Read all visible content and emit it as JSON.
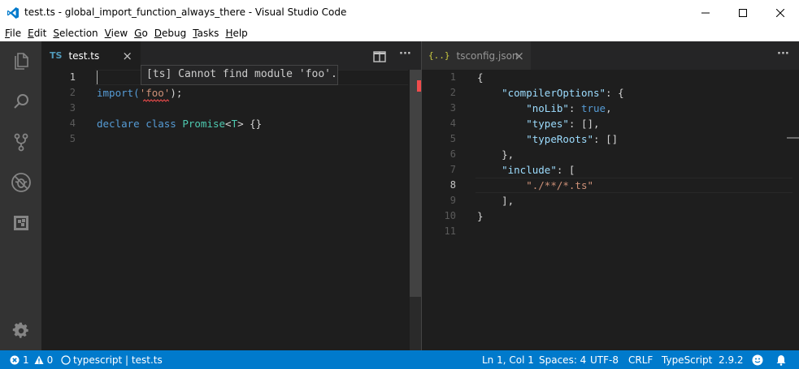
{
  "window": {
    "title": "test.ts - global_import_function_always_there - Visual Studio Code"
  },
  "menu": [
    "File",
    "Edit",
    "Selection",
    "View",
    "Go",
    "Debug",
    "Tasks",
    "Help"
  ],
  "menu_mnemonics": [
    "F",
    "E",
    "S",
    "V",
    "G",
    "D",
    "T",
    "H"
  ],
  "activity_icons": [
    "files-icon",
    "search-icon",
    "source-control-icon",
    "debug-icon",
    "extensions-icon",
    "settings-gear-icon"
  ],
  "left_editor": {
    "tab_lang_badge": "TS",
    "tab_label": "test.ts",
    "close_glyph": "×",
    "more_glyph": "···",
    "hover_text": "[ts] Cannot find module 'foo'.",
    "line_numbers": [
      "1",
      "2",
      "3",
      "4",
      "5"
    ],
    "lines": [
      {
        "parts": []
      },
      {
        "parts": [
          {
            "t": "import(",
            "c": "kw"
          },
          {
            "t": "'foo'",
            "c": "str"
          },
          {
            "t": ");",
            "c": "punc"
          }
        ]
      },
      {
        "parts": []
      },
      {
        "parts": [
          {
            "t": "declare class ",
            "c": "kw"
          },
          {
            "t": "Promise",
            "c": "type"
          },
          {
            "t": "<",
            "c": "punc"
          },
          {
            "t": "T",
            "c": "type"
          },
          {
            "t": "> {}",
            "c": "punc"
          }
        ]
      },
      {
        "parts": []
      }
    ]
  },
  "right_editor": {
    "tab_icon": "{..}",
    "tab_label": "tsconfig.json",
    "close_glyph": "×",
    "more_glyph": "···",
    "line_numbers": [
      "1",
      "2",
      "3",
      "4",
      "5",
      "6",
      "7",
      "8",
      "9",
      "10",
      "11"
    ],
    "lines": [
      {
        "parts": [
          {
            "t": "{",
            "c": "punc"
          }
        ]
      },
      {
        "parts": [
          {
            "t": "    ",
            "c": "punc"
          },
          {
            "t": "\"compilerOptions\"",
            "c": "key"
          },
          {
            "t": ": {",
            "c": "punc"
          }
        ]
      },
      {
        "parts": [
          {
            "t": "        ",
            "c": "punc"
          },
          {
            "t": "\"noLib\"",
            "c": "key"
          },
          {
            "t": ": ",
            "c": "punc"
          },
          {
            "t": "true",
            "c": "kw"
          },
          {
            "t": ",",
            "c": "punc"
          }
        ]
      },
      {
        "parts": [
          {
            "t": "        ",
            "c": "punc"
          },
          {
            "t": "\"types\"",
            "c": "key"
          },
          {
            "t": ": [],",
            "c": "punc"
          }
        ]
      },
      {
        "parts": [
          {
            "t": "        ",
            "c": "punc"
          },
          {
            "t": "\"typeRoots\"",
            "c": "key"
          },
          {
            "t": ": []",
            "c": "punc"
          }
        ]
      },
      {
        "parts": [
          {
            "t": "    },",
            "c": "punc"
          }
        ]
      },
      {
        "parts": [
          {
            "t": "    ",
            "c": "punc"
          },
          {
            "t": "\"include\"",
            "c": "key"
          },
          {
            "t": ": [",
            "c": "punc"
          }
        ]
      },
      {
        "parts": [
          {
            "t": "        ",
            "c": "punc"
          },
          {
            "t": "\"./**/*.ts\"",
            "c": "str"
          }
        ]
      },
      {
        "parts": [
          {
            "t": "    ],",
            "c": "punc"
          }
        ]
      },
      {
        "parts": [
          {
            "t": "}",
            "c": "punc"
          }
        ]
      },
      {
        "parts": []
      }
    ]
  },
  "status": {
    "errors": "1",
    "warnings": "0",
    "language_info": "typescript | test.ts",
    "position": "Ln 1, Col 1",
    "spaces": "Spaces: 4",
    "encoding": "UTF-8",
    "eol": "CRLF",
    "language": "TypeScript",
    "version": "2.9.2"
  },
  "colors": {
    "accent": "#007acc",
    "editor_bg": "#1e1e1e",
    "activity_bg": "#333333",
    "error": "#f48771"
  }
}
